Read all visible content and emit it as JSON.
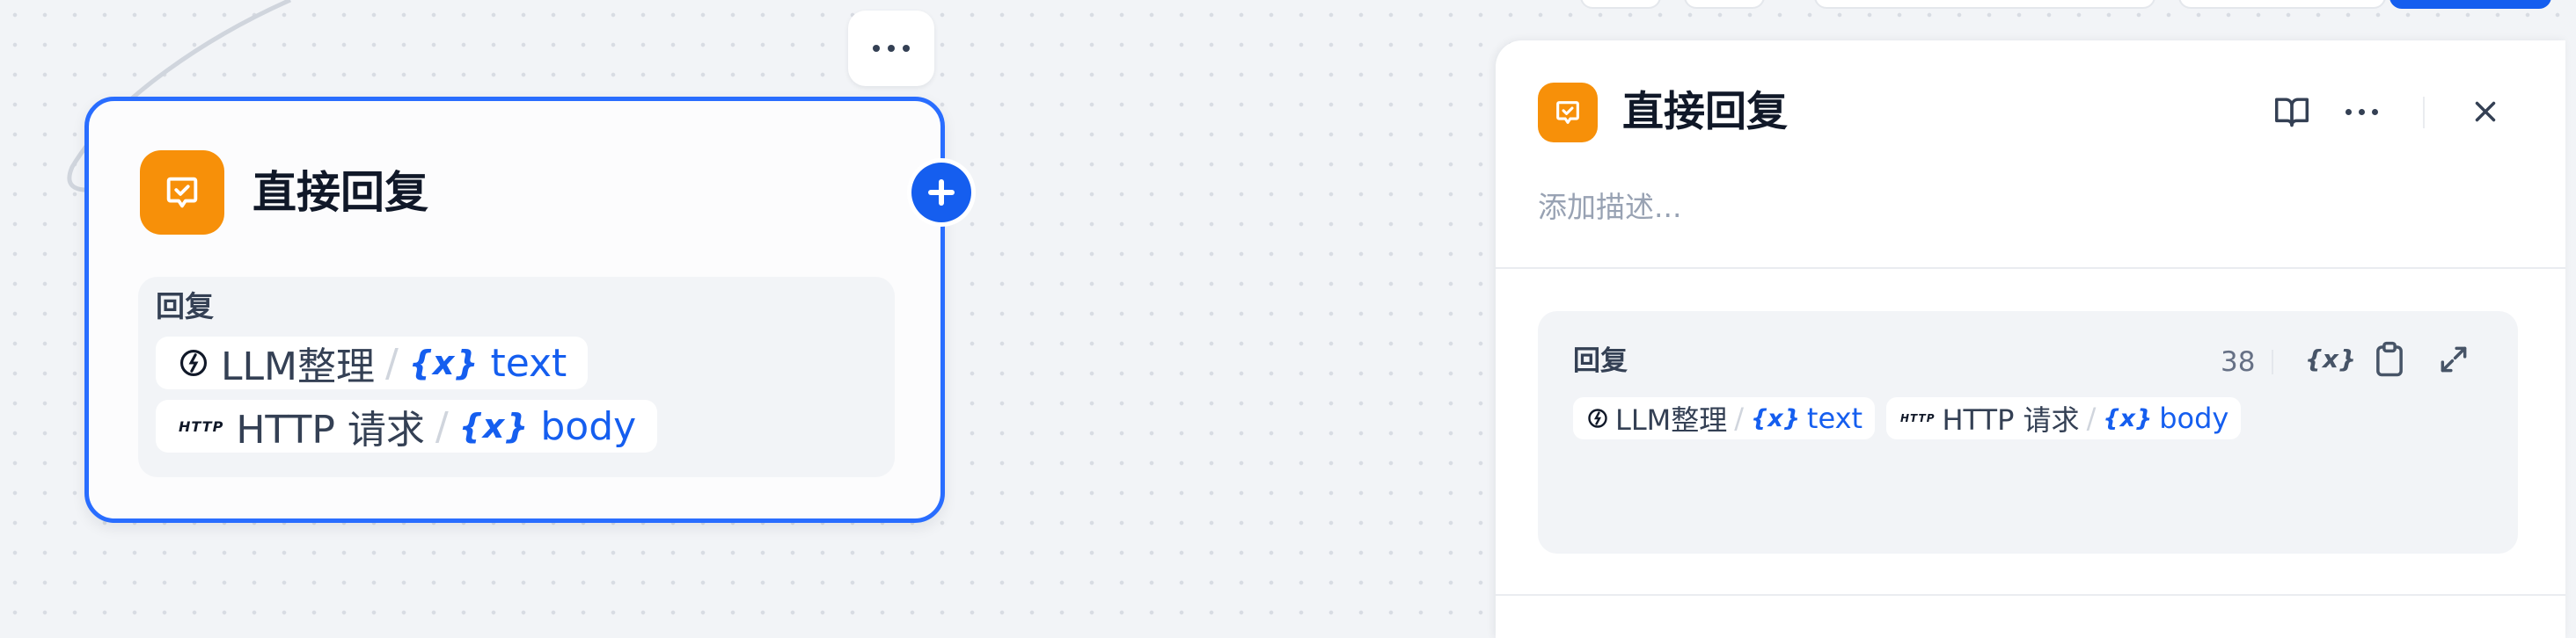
{
  "canvas": {
    "node": {
      "title": "直接回复",
      "icon": "answer-icon",
      "accent_color": "#f79009",
      "border_color": "#296dff",
      "reply_label": "回复",
      "references": [
        {
          "source_icon": "llm-icon",
          "source": "LLM整理",
          "separator": "/",
          "var_icon": "{x}",
          "var": "text"
        },
        {
          "source_icon": "http-icon",
          "source_glyph": "HTTP",
          "source": "HTTP 请求",
          "separator": "/",
          "var_icon": "{x}",
          "var": "body"
        }
      ]
    }
  },
  "panel": {
    "title": "直接回复",
    "icon": "answer-icon",
    "description_placeholder": "添加描述...",
    "reply": {
      "label": "回复",
      "char_count": "38",
      "insert_var_icon": "{x}",
      "references": [
        {
          "source_icon": "llm-icon",
          "source": "LLM整理",
          "separator": "/",
          "var_icon": "{x}",
          "var": "text"
        },
        {
          "source_icon": "http-icon",
          "source_glyph": "HTTP",
          "source": "HTTP 请求",
          "separator": "/",
          "var_icon": "{x}",
          "var": "body"
        }
      ]
    }
  },
  "colors": {
    "primary": "#155eef",
    "node_icon_bg": "#f79009",
    "canvas_bg": "#f2f4f7"
  }
}
